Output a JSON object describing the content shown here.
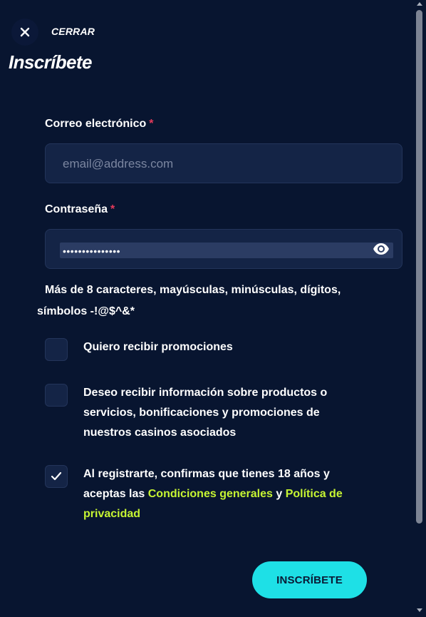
{
  "header": {
    "close_label": "CERRAR",
    "title": "Inscríbete"
  },
  "email": {
    "label": "Correo electrónico",
    "required_mark": "*",
    "placeholder": "email@address.com",
    "value": ""
  },
  "password": {
    "label": "Contraseña",
    "required_mark": "*",
    "value": "•••••••••••••••",
    "hint": "Más de 8 caracteres, mayúsculas, minúsculas, dígitos, símbolos -!@$^&*"
  },
  "checkboxes": [
    {
      "label": "Quiero recibir promociones",
      "checked": false
    },
    {
      "label": "Deseo recibir información sobre productos o servicios, bonificaciones y promociones de nuestros casinos asociados",
      "checked": false
    },
    {
      "label_before": "Al registrarte, confirmas que tienes 18 años y aceptas las ",
      "link1": "Condiciones generales",
      "label_middle": " y ",
      "link2": "Política de privacidad",
      "checked": true
    }
  ],
  "submit_label": "INSCRÍBETE",
  "colors": {
    "background": "#081530",
    "input_bg": "#142446",
    "accent_cyan": "#1ee0e6",
    "link_lime": "#c6f432",
    "required_red": "#e53a5b"
  },
  "icons": {
    "close": "close-icon",
    "password_toggle": "eye-icon",
    "checkmark": "check-icon"
  }
}
